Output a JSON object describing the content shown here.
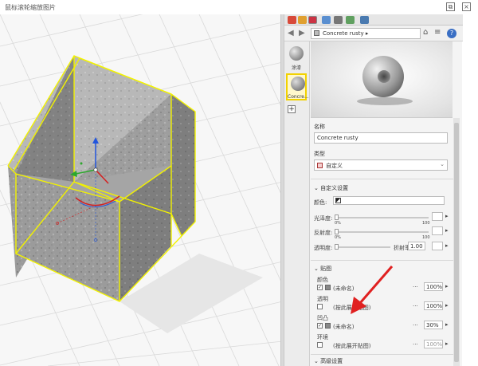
{
  "window": {
    "title": "鼠标滚轮缩放图片",
    "buttons": [
      "restore",
      "close"
    ]
  },
  "colors": {
    "selection_outline": "#f2f200",
    "axis_x": "#2da82d",
    "axis_y": "#2255dd",
    "axis_z": "#d42020",
    "annotation_arrow": "#e02020",
    "help_blue": "#3a6fc4"
  },
  "panel": {
    "tab_icons": [
      "scene-icon",
      "color-icon",
      "material-icon",
      "layer-icon",
      "shadow-icon",
      "styles-icon",
      "display-icon"
    ],
    "nav": {
      "back_icon": "arrow-left-icon",
      "forward_icon": "arrow-right-icon",
      "material_name": "Concrete rusty",
      "help_label": "?"
    },
    "thumbnails": [
      {
        "label": "涂漆"
      },
      {
        "label": "Concre..."
      }
    ],
    "add_label": "+",
    "name_label": "名称",
    "name_value": "Concrete rusty",
    "type_label": "类型",
    "type_value": "自定义",
    "custom_section": "自定义设置",
    "color_label": "颜色:",
    "gloss_label": "光泽度:",
    "reflect_label": "反射度:",
    "transparency_label": "透明度:",
    "ior_label": "折射率",
    "ior_value": "1.00",
    "slider_min": "0%",
    "slider_max": "100",
    "maps_section": "贴图",
    "color_map_label": "颜色",
    "color_map_value": "(未命名)",
    "color_map_percent": "100%",
    "transparency_map_label": "透明",
    "transparency_map_value": "(按此展开贴图)",
    "transparency_map_percent": "100%",
    "bump_map_label": "凹凸",
    "bump_map_value": "(未命名)",
    "bump_map_percent": "30%",
    "env_map_label": "环境",
    "env_map_value": "(按此展开贴图)",
    "env_map_percent": "100%",
    "advanced_section": "高级设置"
  }
}
